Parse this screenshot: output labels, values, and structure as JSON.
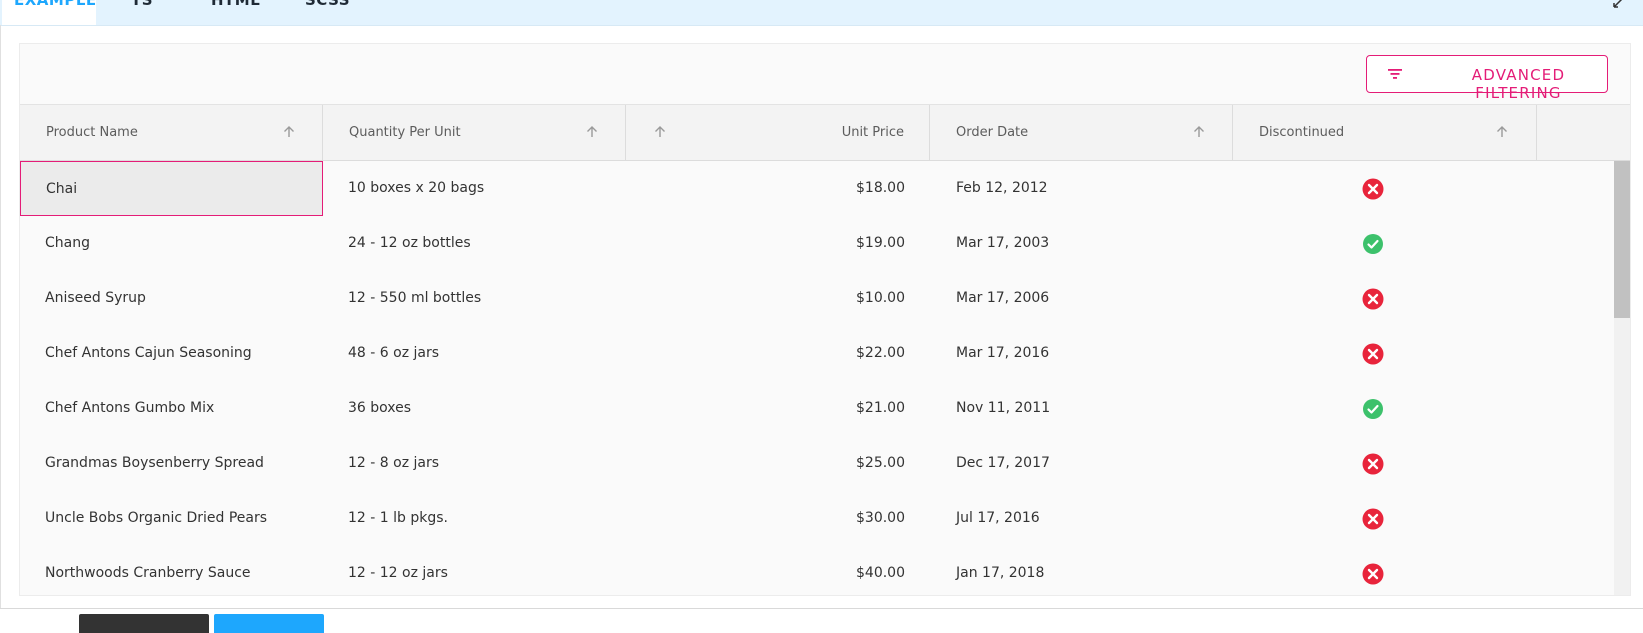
{
  "tabs": [
    "EXAMPLE",
    "TS",
    "HTML",
    "SCSS"
  ],
  "toolbar": {
    "advanced_filtering_label": "ADVANCED FILTERING",
    "filter_icon": "filter-icon"
  },
  "columns": [
    "Product Name",
    "Quantity Per Unit",
    "",
    "Unit Price",
    "Order Date",
    "Discontinued"
  ],
  "rows": [
    {
      "name": "Chai",
      "qty": "10 boxes x 20 bags",
      "price": "$18.00",
      "date": "Feb 12, 2012",
      "discontinued": true
    },
    {
      "name": "Chang",
      "qty": "24 - 12 oz bottles",
      "price": "$19.00",
      "date": "Mar 17, 2003",
      "discontinued": false
    },
    {
      "name": "Aniseed Syrup",
      "qty": "12 - 550 ml bottles",
      "price": "$10.00",
      "date": "Mar 17, 2006",
      "discontinued": true
    },
    {
      "name": "Chef Antons Cajun Seasoning",
      "qty": "48 - 6 oz jars",
      "price": "$22.00",
      "date": "Mar 17, 2016",
      "discontinued": true
    },
    {
      "name": "Chef Antons Gumbo Mix",
      "qty": "36 boxes",
      "price": "$21.00",
      "date": "Nov 11, 2011",
      "discontinued": false
    },
    {
      "name": "Grandmas Boysenberry Spread",
      "qty": "12 - 8 oz jars",
      "price": "$25.00",
      "date": "Dec 17, 2017",
      "discontinued": true
    },
    {
      "name": "Uncle Bobs Organic Dried Pears",
      "qty": "12 - 1 lb pkgs.",
      "price": "$30.00",
      "date": "Jul 17, 2016",
      "discontinued": true
    },
    {
      "name": "Northwoods Cranberry Sauce",
      "qty": "12 - 12 oz jars",
      "price": "$40.00",
      "date": "Jan 17, 2018",
      "discontinued": true
    }
  ],
  "colors": {
    "accent": "#e41c77",
    "tab_active": "#1ea7fd",
    "yes": "#e8243b",
    "no": "#3cc16b"
  }
}
